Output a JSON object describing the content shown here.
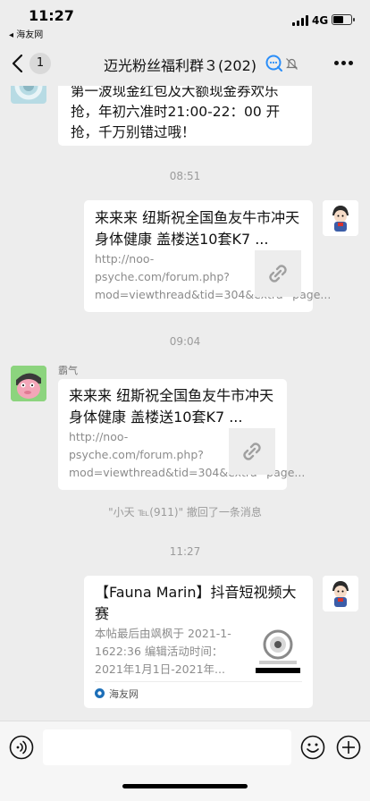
{
  "status_bar": {
    "time": "11:27",
    "back_app": "◂ 海友网",
    "network": "4G",
    "battery_level": 0.62
  },
  "nav": {
    "unread_count": "1",
    "title": "迈光粉丝福利群３(202)"
  },
  "messages": {
    "first": {
      "text": "第一波现金红包及大额现金券欢乐抢，年初六准时21:00-22：00 开抢，千万别错过哦！"
    },
    "time1": "08:51",
    "card1": {
      "title": "来来来 纽斯祝全国鱼友牛市冲天 身体健康 盖楼送10套K7 ...",
      "desc": "http://noo-psyche.com/forum.php?mod=viewthread&tid=304&extra=page..."
    },
    "time2": "09:04",
    "card2": {
      "sender": "霸气",
      "title": "来来来 纽斯祝全国鱼友牛市冲天 身体健康 盖楼送10套K7 ...",
      "desc": "http://noo-psyche.com/forum.php?mod=viewthread&tid=304&extra=page..."
    },
    "recall": "\"小天 ℡(911)\" 撤回了一条消息",
    "time3": "11:27",
    "card3": {
      "title": "【Fauna Marin】抖音短视频大赛",
      "desc": "本帖最后由飒枫于 2021-1-1622:36 编辑活动时间：2021年1月1日-2021年...",
      "source": "海友网"
    }
  },
  "colors": {
    "background": "#ededed",
    "bubble": "#ffffff",
    "accent_blue": "#2b8ef8"
  }
}
